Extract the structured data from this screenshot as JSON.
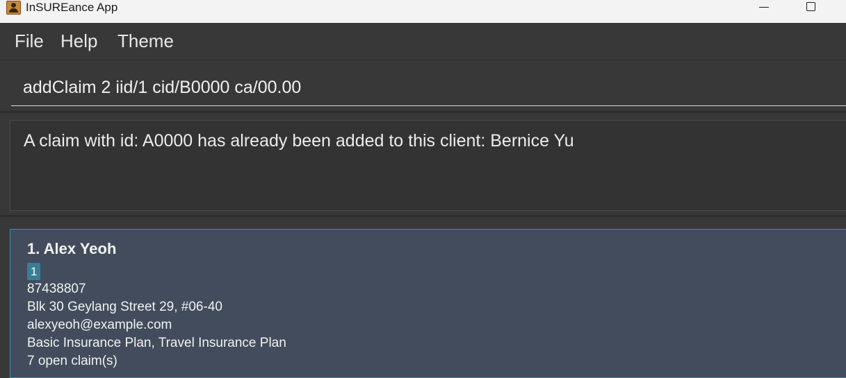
{
  "window": {
    "title": "InSUREance App"
  },
  "menu": {
    "file": "File",
    "help": "Help",
    "theme": "Theme"
  },
  "command": {
    "value": "addClaim 2 iid/1 cid/B0000 ca/00.00"
  },
  "result": {
    "message": "A claim with id: A0000 has already been added to this client: Bernice Yu"
  },
  "persons": [
    {
      "index_name": "1. Alex Yeoh",
      "tag": "1",
      "phone": "87438807",
      "address": "Blk 30 Geylang Street 29, #06-40",
      "email": "alexyeoh@example.com",
      "insurances": "Basic Insurance Plan, Travel Insurance Plan",
      "claims": "7 open claim(s)"
    }
  ],
  "colors": {
    "background": "#383838",
    "card": "#424c5c",
    "card_border": "#3b8fa3",
    "tag": "#3a7d96"
  },
  "icons": {
    "app": "app-person-icon",
    "minimize": "minimize-icon",
    "maximize": "maximize-icon"
  }
}
